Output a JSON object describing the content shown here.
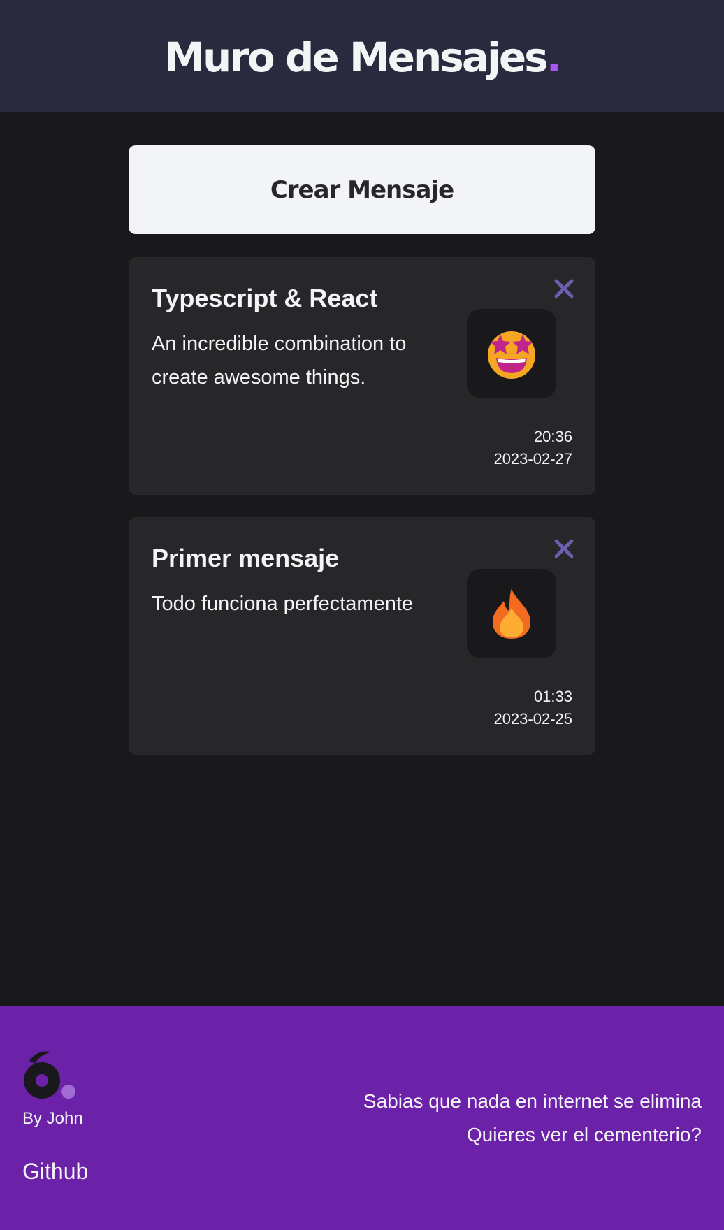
{
  "header": {
    "title": "Muro de Mensajes",
    "title_dot": "."
  },
  "create_button": {
    "label": "Crear Mensaje"
  },
  "messages": [
    {
      "title": "Typescript & React",
      "body": "An incredible combination to create awesome things.",
      "emoji": "star-struck",
      "time": "20:36",
      "date": "2023-02-27"
    },
    {
      "title": "Primer mensaje",
      "body": "Todo funciona perfectamente",
      "emoji": "fire",
      "time": "01:33",
      "date": "2023-02-25"
    }
  ],
  "footer": {
    "by": "By John",
    "github": "Github",
    "note": "Sabias que nada en internet se elimina",
    "cemetery_link": "Quieres ver el cementerio?"
  },
  "colors": {
    "header_bg": "#292a3d",
    "page_bg": "#19191b",
    "card_bg": "#272729",
    "accent": "#a855f7",
    "close_icon": "#6b5fb0",
    "footer_bg": "#6b21a8"
  }
}
